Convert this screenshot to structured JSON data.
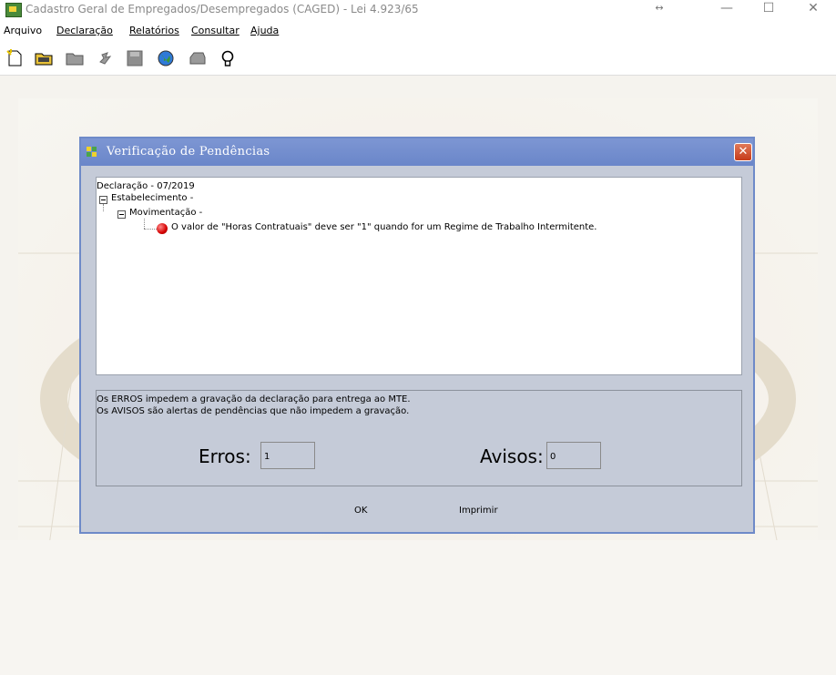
{
  "window": {
    "title": "Cadastro Geral de Empregados/Desempregados (CAGED) - Lei 4.923/65"
  },
  "menu": {
    "items": [
      "Arquivo",
      "Declaração",
      "Relatórios",
      "Consultar",
      "Ajuda"
    ]
  },
  "toolbar": {
    "icons": [
      "new-document-icon",
      "open-folder-icon",
      "folder-icon",
      "verify-icon",
      "save-icon",
      "globe-icon",
      "print-icon",
      "help-bulb-icon"
    ]
  },
  "dialog": {
    "title": "Verificação de Pendências",
    "close_label": "✕",
    "tree": {
      "root": "Declaração  - 07/2019",
      "establishment": "Estabelecimento -",
      "movement": "Movimentação -",
      "error_message": "O valor de \"Horas Contratuais\" deve ser \"1\" quando for um Regime de Trabalho Intermitente."
    },
    "info": {
      "line1": "Os ERROS impedem a gravação da declaração para entrega ao MTE.",
      "line2": "Os AVISOS são alertas de pendências que não impedem a gravação.",
      "errors_label": "Erros:",
      "errors_value": "1",
      "warnings_label": "Avisos:",
      "warnings_value": "0"
    },
    "buttons": {
      "ok": "OK",
      "print": "Imprimir"
    }
  },
  "colors": {
    "dialog_title": "#6a86c9",
    "dialog_body": "#c5cbd8",
    "error": "#d40000"
  }
}
